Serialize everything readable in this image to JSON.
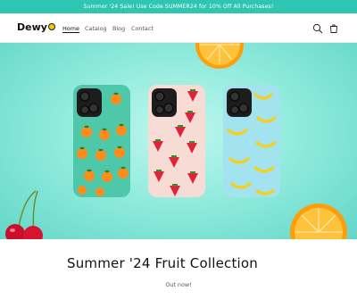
{
  "announcement": {
    "text": "Summer '24 Sale! Use Code SUMMER24 for 10% Off All Purchases!"
  },
  "header": {
    "logo": "Dewy",
    "nav": [
      {
        "label": "Home",
        "active": true
      },
      {
        "label": "Catalog",
        "active": false
      },
      {
        "label": "Blog",
        "active": false
      },
      {
        "label": "Contact",
        "active": false
      }
    ],
    "icons": [
      "search-icon",
      "cart-icon"
    ]
  },
  "hero": {
    "background_color": "#8eeadb",
    "products": [
      {
        "pattern": "oranges",
        "case_color": "#4fc7a9"
      },
      {
        "pattern": "strawberries",
        "case_color": "#f7d9d2"
      },
      {
        "pattern": "bananas",
        "case_color": "#9fe2ee"
      }
    ]
  },
  "collection": {
    "title": "Summer '24 Fruit Collection",
    "subtitle": "Out now!"
  },
  "colors": {
    "accent": "#2ec6b1",
    "text": "#121212"
  }
}
